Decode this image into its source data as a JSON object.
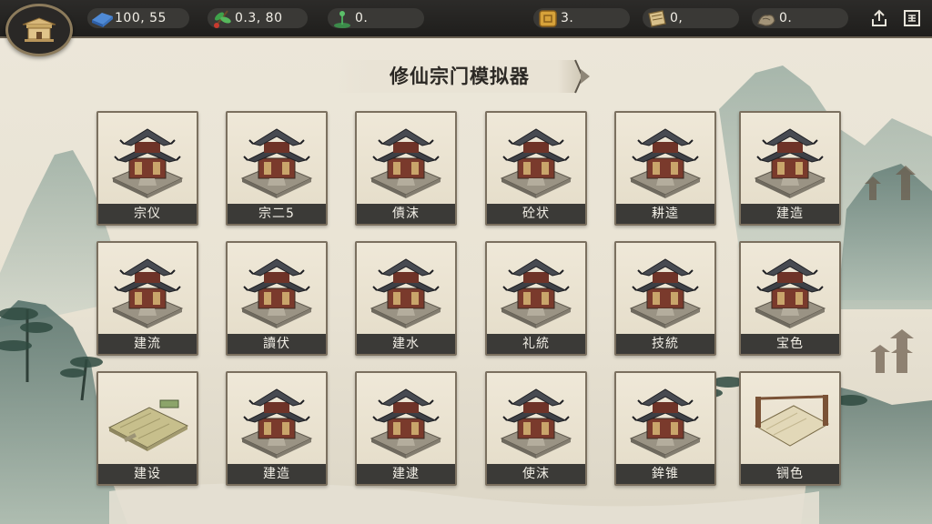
{
  "resources": [
    {
      "icon": "jade-ingot-icon",
      "value": "100, 55"
    },
    {
      "icon": "herb-icon",
      "value": "0.3, 80"
    },
    {
      "icon": "spirit-sprout-icon",
      "value": "0."
    },
    {
      "icon": "gold-crate-icon",
      "value": "3."
    },
    {
      "icon": "scroll-bundle-icon",
      "value": "0,"
    },
    {
      "icon": "stone-ore-icon",
      "value": "0."
    }
  ],
  "header": {
    "title": "修仙宗门模拟器"
  },
  "top_buttons": [
    {
      "icon": "share-icon"
    },
    {
      "icon": "menu-icon"
    }
  ],
  "buildings": [
    {
      "label": "宗仪",
      "icon": "pavilion-icon"
    },
    {
      "label": "宗二5",
      "icon": "pavilion-icon"
    },
    {
      "label": "債沫",
      "icon": "pavilion-icon"
    },
    {
      "label": "砼状",
      "icon": "pavilion-icon"
    },
    {
      "label": "耕逵",
      "icon": "pavilion-icon"
    },
    {
      "label": "建造",
      "icon": "pavilion-icon"
    },
    {
      "label": "建流",
      "icon": "pavilion-icon"
    },
    {
      "label": "讀伏",
      "icon": "pavilion-icon"
    },
    {
      "label": "建水",
      "icon": "pavilion-icon"
    },
    {
      "label": "礼統",
      "icon": "pavilion-icon"
    },
    {
      "label": "技統",
      "icon": "pavilion-icon"
    },
    {
      "label": "宝色",
      "icon": "pavilion-icon"
    },
    {
      "label": "建设",
      "icon": "empty-plot-icon"
    },
    {
      "label": "建造",
      "icon": "pavilion-icon"
    },
    {
      "label": "建逮",
      "icon": "pavilion-icon"
    },
    {
      "label": "使沫",
      "icon": "pavilion-icon"
    },
    {
      "label": "鉾锥",
      "icon": "pavilion-icon"
    },
    {
      "label": "锎色",
      "icon": "scroll-plot-icon"
    }
  ]
}
